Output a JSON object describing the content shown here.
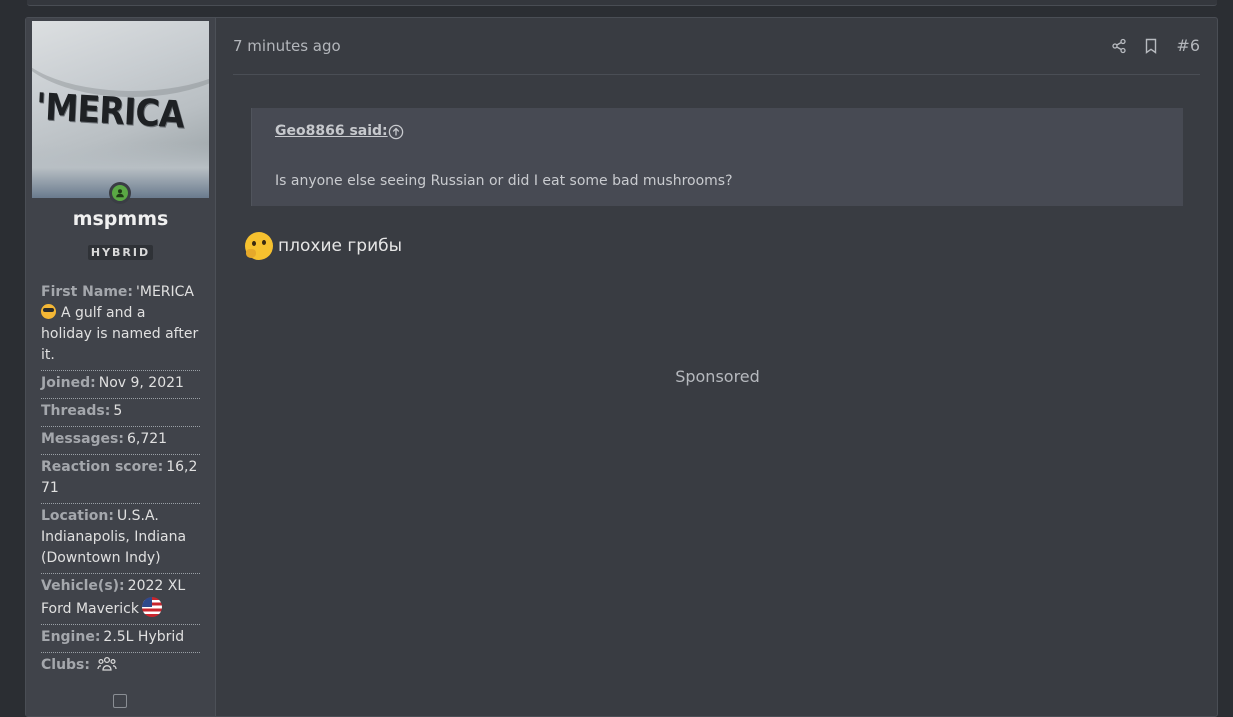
{
  "user": {
    "username": "mspmms",
    "avatar_text": "'MERICA",
    "badge": "HYBRID",
    "fields": [
      {
        "key": "First Name:",
        "value": "'MERICA",
        "extra": "A gulf and a holiday is named after it."
      },
      {
        "key": "Joined:",
        "value": "Nov 9, 2021"
      },
      {
        "key": "Threads:",
        "value": "5"
      },
      {
        "key": "Messages:",
        "value": "6,721"
      },
      {
        "key": "Reaction score:",
        "value": "16,271"
      },
      {
        "key": "Location:",
        "value": "U.S.A. Indianapolis, Indiana (Downtown Indy)"
      },
      {
        "key": "Vehicle(s):",
        "value": "2022 XL Ford Maverick"
      },
      {
        "key": "Engine:",
        "value": "2.5L Hybrid"
      },
      {
        "key": "Clubs:",
        "value": ""
      }
    ]
  },
  "post": {
    "time": "7 minutes ago",
    "number": "#6",
    "quote_author": "Geo8866 said:",
    "quote_text": "Is anyone else seeing Russian or did I eat some bad mushrooms?",
    "reply_text": "плохие грибы",
    "sponsored": "Sponsored"
  },
  "icons": {
    "online": "user-online-icon",
    "share": "share-icon",
    "bookmark": "bookmark-icon",
    "quote_jump": "arrow-up-circle-icon",
    "clubs": "group-icon",
    "collapse": "arrow-up-box-icon"
  },
  "colors": {
    "online": "#5aa844",
    "background": "#2b2e33",
    "post": "#393c42",
    "quote": "#474a53"
  }
}
